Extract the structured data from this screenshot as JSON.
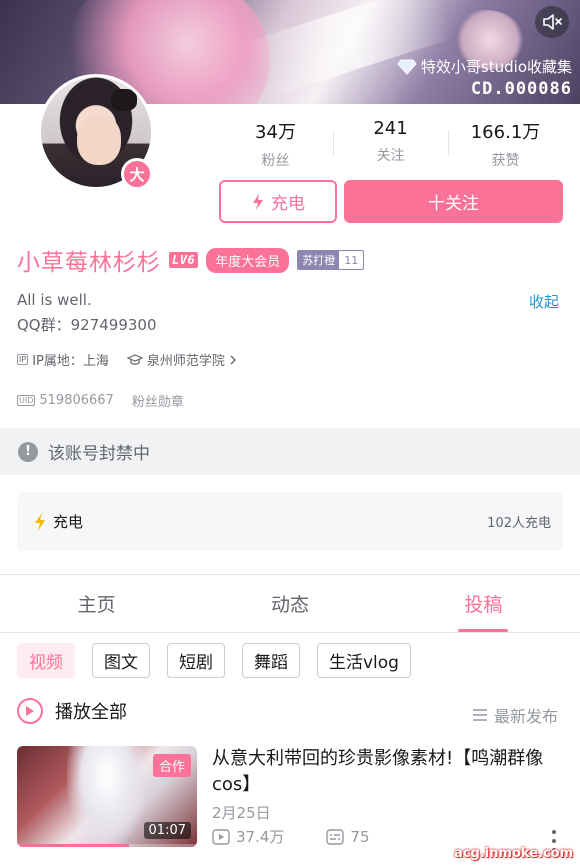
{
  "banner": {
    "collection_label": "特效小哥studio收藏集",
    "collection_serial": "CD.000086"
  },
  "profile": {
    "avatar_badge": "大",
    "name": "小草莓林杉杉",
    "level": "LV6",
    "vip": "年度大会员",
    "medal_name": "苏打橙",
    "medal_level": "11",
    "sign_line1": "All is well.",
    "sign_line2": "QQ群：927499300",
    "collapse": "收起",
    "ip_tag": "IP",
    "ip_location": "IP属地：上海",
    "school": "泉州师范学院",
    "uid_tag": "UID",
    "uid": "519806667",
    "fan_medal": "粉丝勋章"
  },
  "stats": [
    {
      "num": "34万",
      "label": "粉丝"
    },
    {
      "num": "241",
      "label": "关注"
    },
    {
      "num": "166.1万",
      "label": "获赞"
    }
  ],
  "buttons": {
    "charge": "充电",
    "follow": "十关注"
  },
  "banned_notice": "该账号封禁中",
  "charge_card": {
    "title": "充电",
    "count": "102人充电"
  },
  "tabs": [
    "主页",
    "动态",
    "投稿"
  ],
  "chips": [
    "视频",
    "图文",
    "短剧",
    "舞蹈",
    "生活vlog"
  ],
  "list_header": {
    "play_all": "播放全部",
    "sort": "最新发布"
  },
  "video": {
    "badge": "合作",
    "duration": "01:07",
    "watch_progress": 0.62,
    "title": "从意大利带回的珍贵影像素材!【鸣潮群像cos】",
    "date": "2月25日",
    "views": "37.4万",
    "danmaku": "75"
  },
  "watermark": "acg.inmoke.com",
  "colors": {
    "accent": "#fb7299",
    "link": "#2a95c6",
    "muted": "#9499a0"
  }
}
